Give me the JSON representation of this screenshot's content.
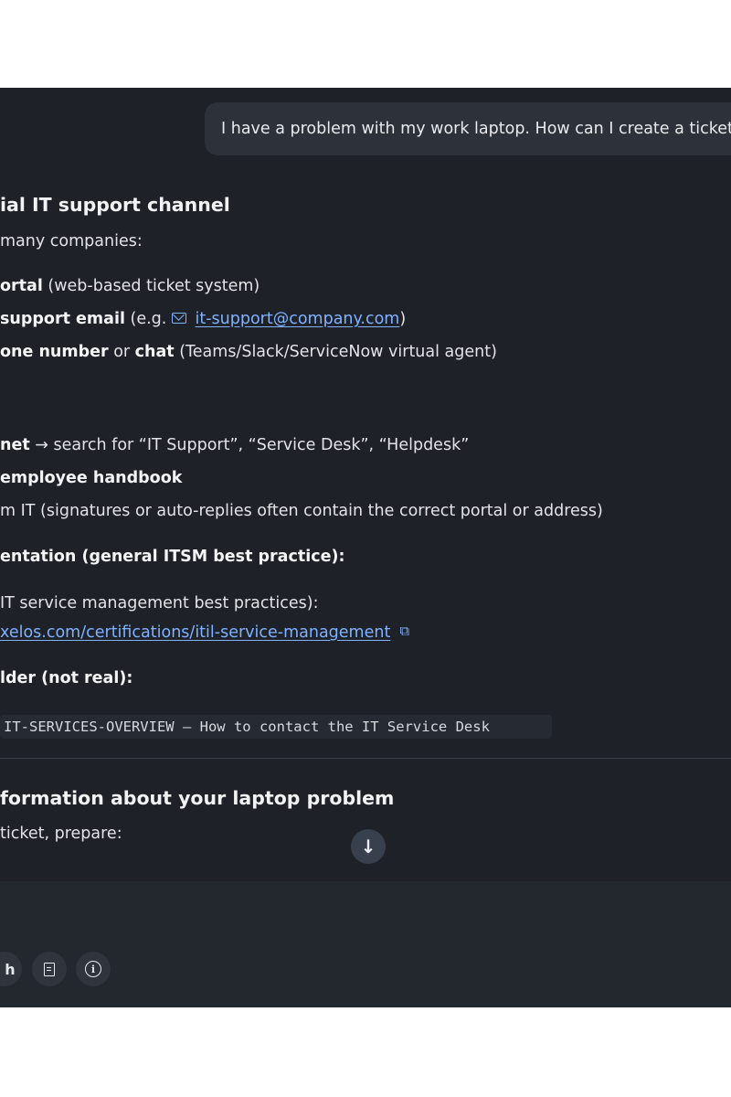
{
  "conversation": {
    "user_message": "I have a problem with my work laptop. How can I create a ticket",
    "section1": {
      "heading": "ial IT support channel",
      "intro": "many companies:",
      "items": [
        {
          "bold": "ortal",
          "rest": " (web-based ticket system)"
        },
        {
          "bold": "support email",
          "prefix": " (e.g. ",
          "link": "it-support@company.com",
          "suffix": ")"
        },
        {
          "bold": "one number",
          "mid": " or ",
          "bold2": "chat",
          "rest": " (Teams/Slack/ServiceNow virtual agent)"
        }
      ]
    },
    "tips": [
      {
        "bold": "net",
        "rest": " → search for “IT Support”, “Service Desk”, “Helpdesk”"
      },
      {
        "bold": "employee handbook",
        "rest": ""
      },
      {
        "bold": "",
        "rest": "m IT (signatures or auto-replies often contain the correct portal or address)"
      }
    ],
    "docs": {
      "heading": "entation (general ITSM best practice):",
      "line": "IT service management best practices):",
      "link": "xelos.com/certifications/itil-service-management"
    },
    "placeholder": {
      "heading": "lder (not real):",
      "code": "IT-SERVICES-OVERVIEW – How to contact the IT Service Desk"
    },
    "section2": {
      "heading": "formation about your laptop problem",
      "intro": "ticket, prepare:"
    }
  },
  "scroll_button": {
    "icon": "arrow-down-icon",
    "glyph": "↓"
  },
  "composer": {
    "partial_label": "h",
    "icons": [
      "document-icon",
      "info-icon"
    ]
  }
}
